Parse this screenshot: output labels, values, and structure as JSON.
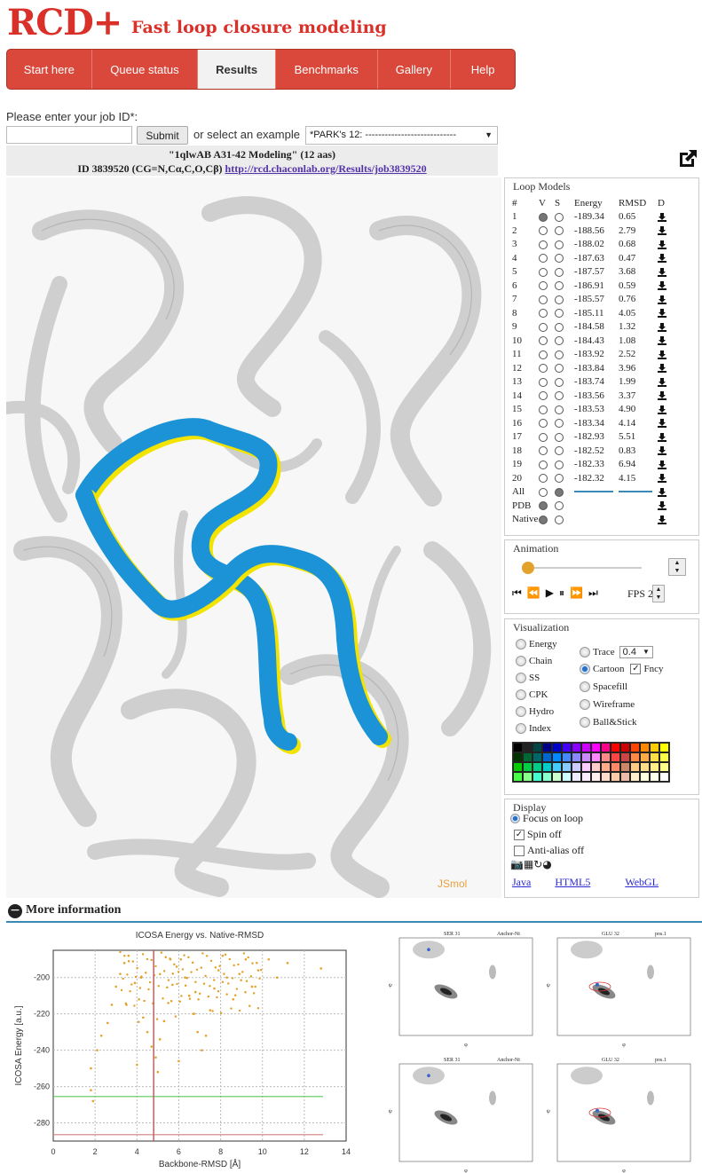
{
  "brand": {
    "logo": "RCD+",
    "tagline": "Fast loop closure modeling"
  },
  "nav": [
    "Start here",
    "Queue status",
    "Results",
    "Benchmarks",
    "Gallery",
    "Help"
  ],
  "nav_active": "Results",
  "job": {
    "prompt": "Please enter your job ID*:",
    "submit": "Submit",
    "or": "or select an example",
    "example": "*PARK's 12: ----------------------------",
    "title": "\"1qlwAB A31-42 Modeling\" (12 aas)",
    "id_text": "ID 3839520 (CG=N,Cα,C,O,Cβ)",
    "link": "http://rcd.chaconlab.org/Results/job3839520"
  },
  "viewer": {
    "watermark": "JSmol"
  },
  "loop_models": {
    "title": "Loop Models",
    "headers": [
      "#",
      "V",
      "S",
      "Energy",
      "RMSD",
      "D"
    ],
    "rows": [
      [
        "1",
        "-189.34",
        "0.65"
      ],
      [
        "2",
        "-188.56",
        "2.79"
      ],
      [
        "3",
        "-188.02",
        "0.68"
      ],
      [
        "4",
        "-187.63",
        "0.47"
      ],
      [
        "5",
        "-187.57",
        "3.68"
      ],
      [
        "6",
        "-186.91",
        "0.59"
      ],
      [
        "7",
        "-185.57",
        "0.76"
      ],
      [
        "8",
        "-185.11",
        "4.05"
      ],
      [
        "9",
        "-184.58",
        "1.32"
      ],
      [
        "10",
        "-184.43",
        "1.08"
      ],
      [
        "11",
        "-183.92",
        "2.52"
      ],
      [
        "12",
        "-183.84",
        "3.96"
      ],
      [
        "13",
        "-183.74",
        "1.99"
      ],
      [
        "14",
        "-183.56",
        "3.37"
      ],
      [
        "15",
        "-183.53",
        "4.90"
      ],
      [
        "16",
        "-183.34",
        "4.14"
      ],
      [
        "17",
        "-182.93",
        "5.51"
      ],
      [
        "18",
        "-182.52",
        "0.83"
      ],
      [
        "19",
        "-182.33",
        "6.94"
      ],
      [
        "20",
        "-182.32",
        "4.15"
      ]
    ],
    "all": "All",
    "pdb": "PDB",
    "native": "Native"
  },
  "animation": {
    "title": "Animation",
    "fps_label": "FPS",
    "fps_value": "2"
  },
  "visualization": {
    "title": "Visualization",
    "left": [
      "Energy",
      "Chain",
      "SS",
      "CPK",
      "Hydro",
      "Index"
    ],
    "right": [
      "Trace",
      "Cartoon",
      "Spacefill",
      "Wireframe",
      "Ball&Stick"
    ],
    "trace_value": "0.4",
    "fancy": "Fncy"
  },
  "display": {
    "title": "Display",
    "focus": "Focus on loop",
    "spin": "Spin off",
    "antialias": "Anti-alias off",
    "links": [
      "Java",
      "HTML5",
      "WebGL"
    ]
  },
  "more_info": "More information",
  "chart_data": {
    "type": "scatter",
    "title": "ICOSA Energy vs. Native-RMSD",
    "xlabel": "Backbone-RMSD [Å]",
    "ylabel": "ICOSA Energy [a.u.]",
    "xlim": [
      0,
      14
    ],
    "ylim": [
      -290,
      -185
    ],
    "xticks": [
      0,
      2,
      4,
      6,
      8,
      10,
      12,
      14
    ],
    "yticks": [
      -200,
      -220,
      -240,
      -260,
      -280
    ],
    "hlines": [
      {
        "y": -265.5,
        "color": "#5ac85a"
      },
      {
        "y": -286.5,
        "color": "#d08080"
      }
    ],
    "vline": {
      "x": 4.8,
      "color": "#c06060"
    },
    "points": [
      [
        1.8,
        -262
      ],
      [
        1.9,
        -268
      ],
      [
        1.8,
        -250
      ],
      [
        2.1,
        -240
      ],
      [
        2.3,
        -232
      ],
      [
        2.6,
        -225
      ],
      [
        2.8,
        -215
      ],
      [
        3.0,
        -205
      ],
      [
        3.2,
        -198
      ],
      [
        3.4,
        -192
      ],
      [
        3.6,
        -188
      ],
      [
        3.9,
        -203
      ],
      [
        4.1,
        -212
      ],
      [
        4.3,
        -222
      ],
      [
        4.5,
        -230
      ],
      [
        4.7,
        -238
      ],
      [
        4.9,
        -244
      ],
      [
        5.1,
        -234
      ],
      [
        5.3,
        -224
      ],
      [
        5.5,
        -214
      ],
      [
        5.7,
        -204
      ],
      [
        5.9,
        -194
      ],
      [
        6.1,
        -190
      ],
      [
        6.3,
        -200
      ],
      [
        6.5,
        -210
      ],
      [
        6.7,
        -220
      ],
      [
        6.9,
        -230
      ],
      [
        7.1,
        -240
      ],
      [
        7.3,
        -232
      ],
      [
        7.5,
        -218
      ],
      [
        7.7,
        -206
      ],
      [
        7.9,
        -196
      ],
      [
        8.1,
        -188
      ],
      [
        8.3,
        -200
      ],
      [
        8.6,
        -212
      ],
      [
        8.9,
        -198
      ],
      [
        9.2,
        -190
      ],
      [
        9.5,
        -205
      ],
      [
        9.8,
        -196
      ],
      [
        10.3,
        -190
      ],
      [
        10.7,
        -200
      ],
      [
        11.2,
        -192
      ],
      [
        12.8,
        -195
      ],
      [
        4.0,
        -248
      ],
      [
        5.0,
        -252
      ],
      [
        6.0,
        -246
      ],
      [
        3.5,
        -215
      ],
      [
        4.2,
        -200
      ],
      [
        5.6,
        -190
      ],
      [
        6.8,
        -208
      ]
    ]
  },
  "ramachandran": {
    "panels": [
      {
        "residue": "SER 31",
        "label": "Anchor-Nt"
      },
      {
        "residue": "GLU 32",
        "label": "pos.1"
      },
      {
        "residue": "SER 31",
        "label": "Anchor-Nt"
      },
      {
        "residue": "GLU 32",
        "label": "pos.1"
      }
    ],
    "xlabel": "φ",
    "ylabel": "ψ"
  }
}
